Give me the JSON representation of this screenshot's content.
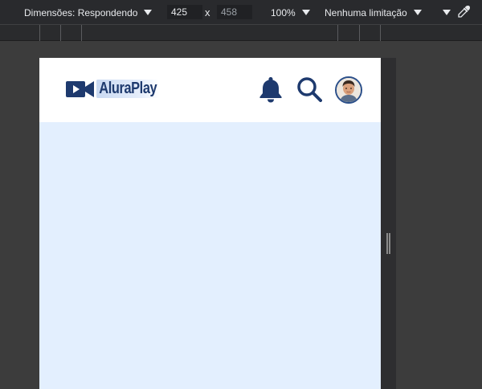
{
  "toolbar": {
    "dimensions_label": "Dimensões: Respondendo",
    "width_value": "425",
    "height_value": "458",
    "times_symbol": "x",
    "zoom_label": "100%",
    "throttle_label": "Nenhuma limitação",
    "icons": [
      "caret-down-icon",
      "eyedropper-icon"
    ]
  },
  "site": {
    "logo_text": "AluraPlay",
    "icons": [
      "video-camera-icon",
      "bell-icon",
      "search-icon",
      "avatar"
    ],
    "brand_color": "#1e3a6e",
    "body_color": "#e3effe"
  }
}
